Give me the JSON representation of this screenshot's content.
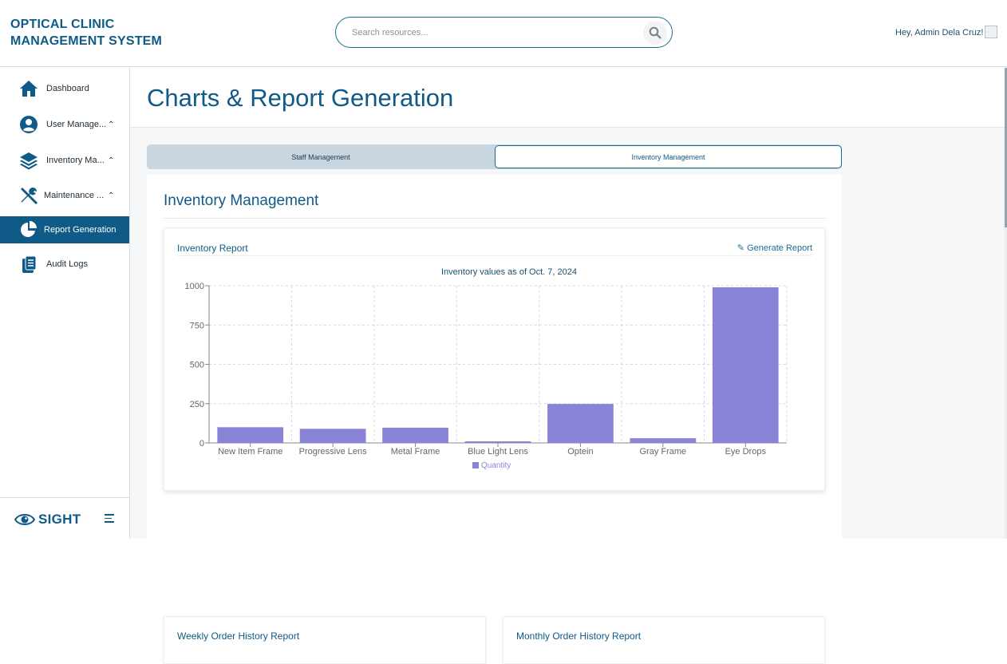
{
  "header": {
    "brand_line1": "OPTICAL CLINIC",
    "brand_line2": "MANAGEMENT SYSTEM",
    "search_placeholder": "Search resources...",
    "greeting": "Hey, Admin Dela Cruz!"
  },
  "sidebar": {
    "items": [
      {
        "label": "Dashboard",
        "icon": "home-icon"
      },
      {
        "label": "User Manage...",
        "icon": "user-icon"
      },
      {
        "label": "Inventory Ma...",
        "icon": "layers-icon"
      },
      {
        "label": "Maintenance ...",
        "icon": "tools-icon"
      },
      {
        "label": "Report Generation",
        "icon": "pie-chart-icon"
      },
      {
        "label": "Audit Logs",
        "icon": "clipboard-icon"
      }
    ],
    "footer_logo": "SIGHT"
  },
  "page": {
    "title": "Charts & Report Generation",
    "tabs": [
      "Staff Management",
      "Inventory Management"
    ],
    "active_tab": "Inventory Management",
    "section_title": "Inventory Management",
    "card_title": "Inventory Report",
    "generate_label": "Generate Report",
    "bottom_cards": [
      "Weekly Order History Report",
      "Monthly Order History Report"
    ]
  },
  "colors": {
    "primary": "#0f5a87",
    "bar": "#8a84d8"
  },
  "chart_data": {
    "type": "bar",
    "title": "Inventory values as of Oct. 7, 2024",
    "categories": [
      "New Item Frame",
      "Progressive Lens",
      "Metal Frame",
      "Blue Light Lens",
      "Optein",
      "Gray Frame",
      "Eye Drops"
    ],
    "series": [
      {
        "name": "Quantity",
        "values": [
          100,
          90,
          97,
          10,
          248,
          30,
          990
        ]
      }
    ],
    "ylim": [
      0,
      1000
    ],
    "yticks": [
      0,
      250,
      500,
      750,
      1000
    ],
    "grid": true,
    "legend": "bottom"
  }
}
